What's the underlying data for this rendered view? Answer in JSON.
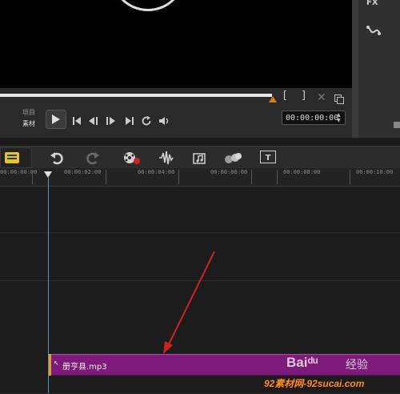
{
  "player": {
    "mode_project": "项目",
    "mode_clip": "素材",
    "mark_in": "[",
    "mark_out": "]",
    "timecode": "00:00:00:00",
    "progress_fraction": 0.68
  },
  "side_panel": {
    "fx_label": "FX"
  },
  "toolbar": {
    "icons": [
      "storyboard-icon",
      "undo-icon",
      "redo-icon",
      "record-capture-icon",
      "sound-mixer-icon",
      "auto-music-icon",
      "motion-track-icon",
      "title-icon"
    ]
  },
  "ruler": {
    "ticks": [
      "00:00:00:00",
      "00:00:02:00",
      "00:00:04:00",
      "00:00:06:00",
      "00:00:08:00",
      "00:00:10:00"
    ]
  },
  "timeline": {
    "audio_clip_name": "册亨县.mp3"
  },
  "colors": {
    "audio_clip": "#7e1a7a",
    "playhead": "#5a8fc8",
    "annotation_arrow": "#d42020",
    "marker": "#e07a10"
  },
  "watermark": {
    "baidu": "Baiᵈᵘ",
    "jingyan": "经验",
    "site": "92素材网-92sucai.com"
  }
}
